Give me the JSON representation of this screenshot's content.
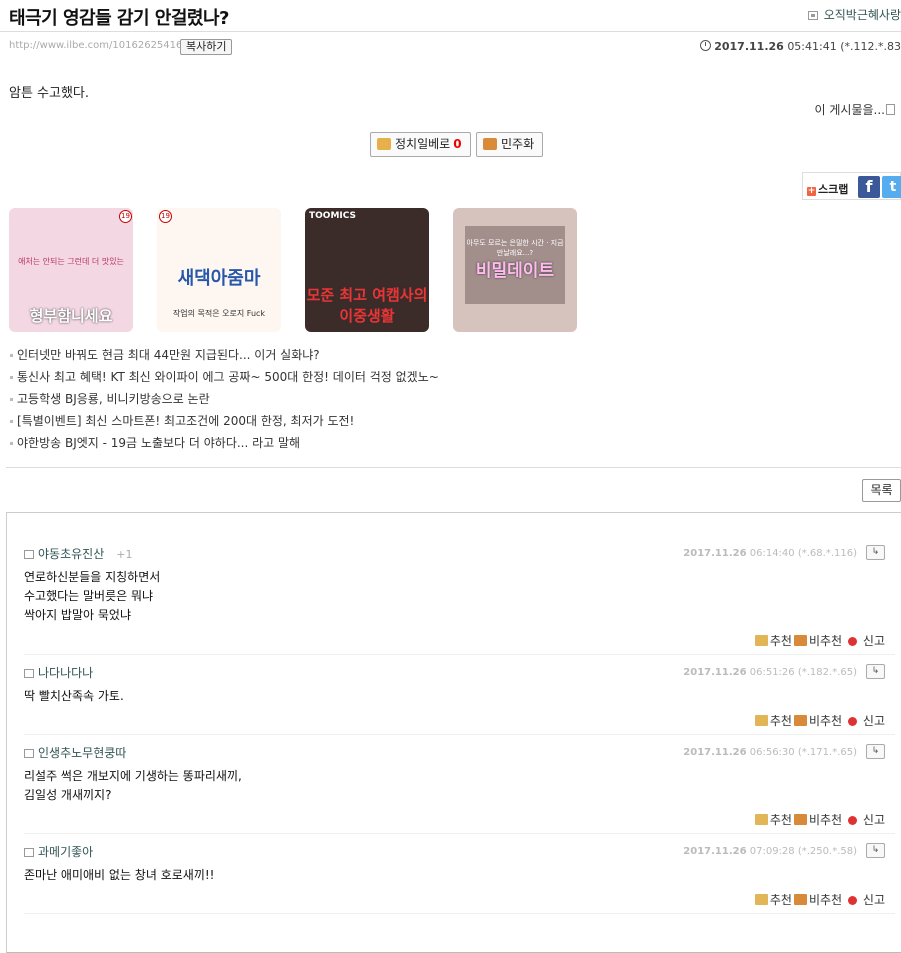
{
  "post": {
    "title": "태극기 영감들 감기 안걸렸나?",
    "author": "오직박근혜사랑",
    "url": "http://www.ilbe.com/10162625416",
    "copy_label": "복사하기",
    "date": "2017.11.26",
    "time": "05:41:41",
    "ip": "(*.112.*.83",
    "body": "암튼 수고했다.",
    "view_link": "이 게시물을...",
    "upvote_label": "정치일베로",
    "upvote_count": "0",
    "downvote_label": "민주화"
  },
  "share": {
    "scrap_label": "스크랩",
    "facebook": "f",
    "twitter": "t"
  },
  "ads": [
    {
      "caption": "형부함니세요",
      "subtitle": "애처는 안되는 그런데 더 맛있는",
      "age": "19",
      "bg": "#f3d7e2",
      "color": "#fff"
    },
    {
      "caption": "새댁아줌마",
      "subtitle": "작업의 목적은 오로지 Fuck",
      "age": "19",
      "bg": "#fdf6f1",
      "color": "#2a56a8"
    },
    {
      "caption": "모준 최고 여캠사의 이중생활",
      "subtitle": "TOOMICS",
      "age": "",
      "bg": "#3b2c2a",
      "color": "#e33"
    },
    {
      "caption": "비밀데이트",
      "subtitle": "아무도 모르는 은밀한 시간 · 지금 만날래요...?",
      "age": "",
      "bg": "#d6c3bd",
      "color": "#fbe"
    }
  ],
  "links": [
    "인터넷만 바꿔도 현금 최대 44만원 지급된다... 이거 실화냐?",
    "통신사 최고 혜택! KT 최신 와이파이 에그 공짜~ 500대 한정! 데이터 걱정 없겠노~",
    "고등학생 BJ응룡, 비니키방송으로 논란",
    "[특별이벤트] 최신 스마트폰! 최고조건에 200대 한정, 최저가 도전!",
    "야한방송 BJ엣지 - 19금 노출보다 더 야하다... 라고 말해"
  ],
  "list_button": "목록",
  "actions": {
    "up": "추천",
    "down": "비추천",
    "report": "신고",
    "reply_icon": "reply-icon"
  },
  "comments": [
    {
      "nick": "야동초유진산",
      "plus": "+1",
      "date": "2017.11.26",
      "time": "06:14:40",
      "ip": "(*.68.*.116)",
      "lines": [
        "연로하신분들을 지칭하면서",
        "수고했다는 말버릇은 뭐냐",
        "싹아지 밥말아 묵었냐"
      ]
    },
    {
      "nick": "나다나다나",
      "plus": "",
      "date": "2017.11.26",
      "time": "06:51:26",
      "ip": "(*.182.*.65)",
      "lines": [
        "딱 빨치산족속 가토."
      ]
    },
    {
      "nick": "인생추노무현쿵따",
      "plus": "",
      "date": "2017.11.26",
      "time": "06:56:30",
      "ip": "(*.171.*.65)",
      "lines": [
        "리설주 썩은 개보지에 기생하는 똥파리새끼,",
        "김일성 개새끼지?"
      ]
    },
    {
      "nick": "과메기좋아",
      "plus": "",
      "date": "2017.11.26",
      "time": "07:09:28",
      "ip": "(*.250.*.58)",
      "lines": [
        "존마난 애미애비 없는 창녀 호로새끼!!"
      ]
    }
  ]
}
